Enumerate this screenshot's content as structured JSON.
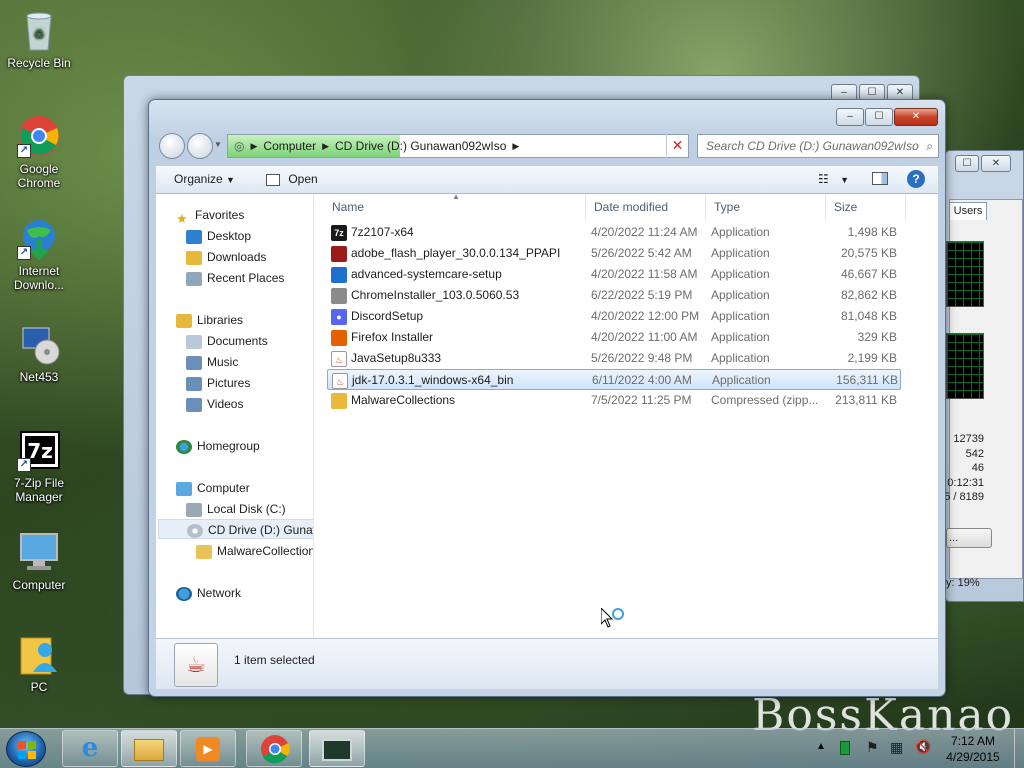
{
  "desktop": {
    "icons": [
      {
        "label": "Recycle Bin"
      },
      {
        "label": "Google Chrome"
      },
      {
        "label": "Internet Downlo..."
      },
      {
        "label": "Net453"
      },
      {
        "label": "7-Zip File Manager"
      },
      {
        "label": "Computer"
      },
      {
        "label": "PC"
      }
    ],
    "watermark": "BossKanao"
  },
  "task_manager": {
    "tab": "Users",
    "numbers": [
      "12739",
      "542",
      "46",
      "0:12:31",
      "5 / 8189"
    ],
    "button": "...",
    "status": "y: 19%"
  },
  "explorer": {
    "breadcrumb": [
      "Computer",
      "CD Drive (D:) Gunawan092wIso"
    ],
    "search_placeholder": "Search CD Drive (D:) Gunawan092wIso",
    "toolbar": {
      "organize": "Organize",
      "open": "Open"
    },
    "nav": {
      "favorites": "Favorites",
      "desktop": "Desktop",
      "downloads": "Downloads",
      "recent": "Recent Places",
      "libraries": "Libraries",
      "documents": "Documents",
      "music": "Music",
      "pictures": "Pictures",
      "videos": "Videos",
      "homegroup": "Homegroup",
      "computer": "Computer",
      "local_disk": "Local Disk (C:)",
      "cd_drive": "CD Drive (D:) Gunaw",
      "malware": "MalwareCollection",
      "network": "Network"
    },
    "columns": {
      "name": "Name",
      "date": "Date modified",
      "type": "Type",
      "size": "Size"
    },
    "files": [
      {
        "name": "7z2107-x64",
        "date": "4/20/2022 11:24 AM",
        "type": "Application",
        "size": "1,498 KB",
        "icon": "7z-icon",
        "color": "#1a1a1a"
      },
      {
        "name": "adobe_flash_player_30.0.0.134_PPAPI",
        "date": "5/26/2022 5:42 AM",
        "type": "Application",
        "size": "20,575 KB",
        "icon": "flash-icon",
        "color": "#9b1b1b"
      },
      {
        "name": "advanced-systemcare-setup",
        "date": "4/20/2022 11:58 AM",
        "type": "Application",
        "size": "46,667 KB",
        "icon": "systemcare-icon",
        "color": "#1f6fd1"
      },
      {
        "name": "ChromeInstaller_103.0.5060.53",
        "date": "6/22/2022 5:19 PM",
        "type": "Application",
        "size": "82,862 KB",
        "icon": "installer-icon",
        "color": "#8a8a8a"
      },
      {
        "name": "DiscordSetup",
        "date": "4/20/2022 12:00 PM",
        "type": "Application",
        "size": "81,048 KB",
        "icon": "discord-icon",
        "color": "#5865f2"
      },
      {
        "name": "Firefox Installer",
        "date": "4/20/2022 11:00 AM",
        "type": "Application",
        "size": "329 KB",
        "icon": "firefox-icon",
        "color": "#e66000"
      },
      {
        "name": "JavaSetup8u333",
        "date": "5/26/2022 9:48 PM",
        "type": "Application",
        "size": "2,199 KB",
        "icon": "java-icon",
        "color": "#c0392b"
      },
      {
        "name": "jdk-17.0.3.1_windows-x64_bin",
        "date": "6/11/2022 4:00 AM",
        "type": "Application",
        "size": "156,311 KB",
        "icon": "java-icon",
        "color": "#c0392b"
      },
      {
        "name": "MalwareCollections",
        "date": "7/5/2022 11:25 PM",
        "type": "Compressed (zipp...",
        "size": "213,811 KB",
        "icon": "zip-folder-icon",
        "color": "#e8b93b"
      }
    ],
    "selected_index": 7,
    "status": "1 item selected"
  },
  "taskbar": {
    "time": "7:12 AM",
    "date": "4/29/2015"
  }
}
